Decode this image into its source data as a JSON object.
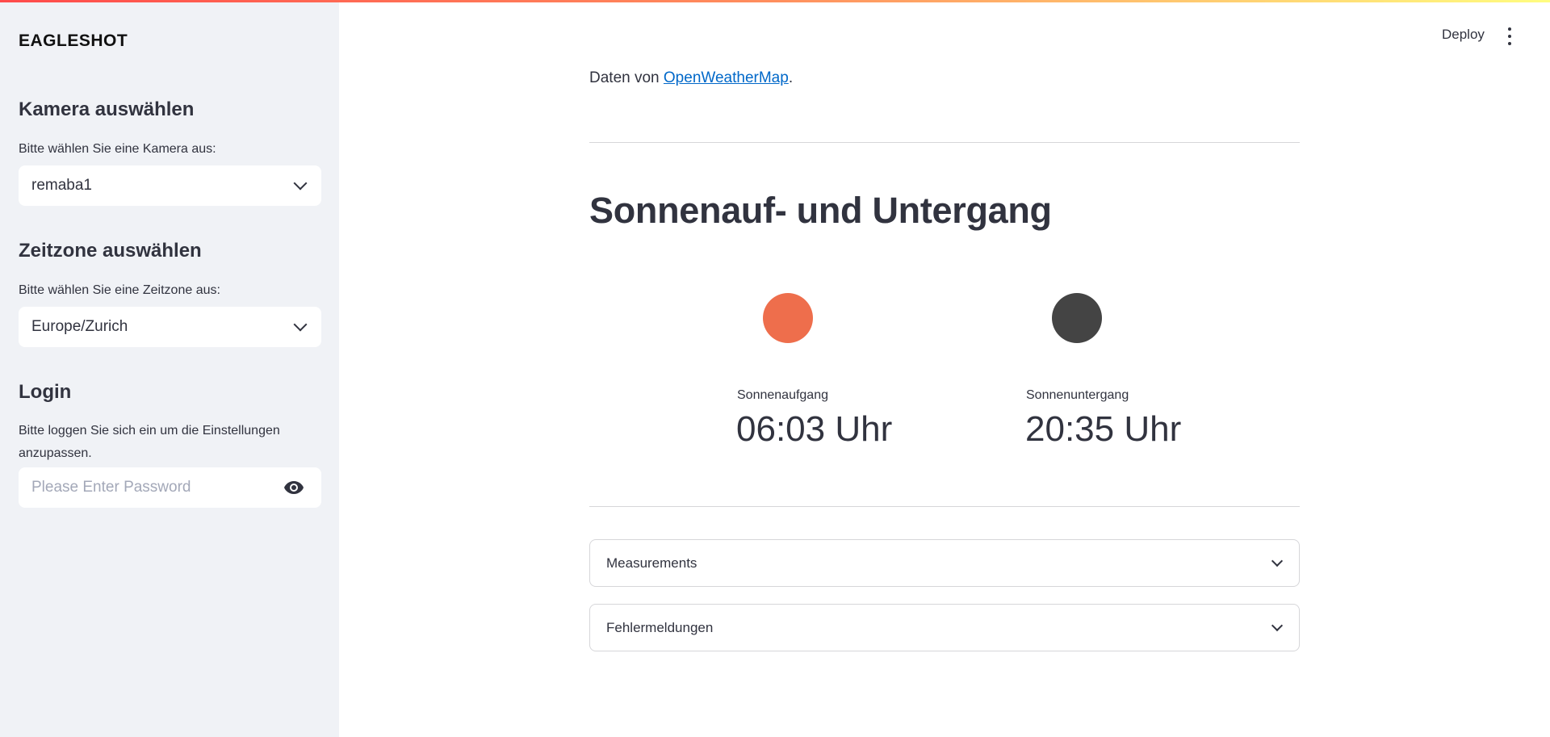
{
  "colors": {
    "accent_gradient": [
      "#ff4b4b",
      "#ff8f5e",
      "#fffd80"
    ],
    "sidebar_bg": "#f0f2f6",
    "link": "#0068c9",
    "sunrise_dot": "#ee6e4c",
    "sunset_dot": "#444444"
  },
  "sidebar": {
    "logo": "EAGLESHOT",
    "camera": {
      "heading": "Kamera auswählen",
      "label": "Bitte wählen Sie eine Kamera aus:",
      "selected": "remaba1"
    },
    "timezone": {
      "heading": "Zeitzone auswählen",
      "label": "Bitte wählen Sie eine Zeitzone aus:",
      "selected": "Europe/Zurich"
    },
    "login": {
      "heading": "Login",
      "label": "Bitte loggen Sie sich ein um die Einstellungen anzupassen.",
      "password_placeholder": "Please Enter Password",
      "password_value": ""
    }
  },
  "header": {
    "deploy_label": "Deploy",
    "menu_icon": "kebab-menu-icon"
  },
  "main": {
    "source_prefix": "Daten von ",
    "source_link": "OpenWeatherMap",
    "source_suffix": ".",
    "title": "Sonnenauf- und Untergang",
    "sunrise": {
      "label": "Sonnenaufgang",
      "value": "06:03 Uhr"
    },
    "sunset": {
      "label": "Sonnenuntergang",
      "value": "20:35 Uhr"
    },
    "expanders": [
      {
        "label": "Measurements"
      },
      {
        "label": "Fehlermeldungen"
      }
    ]
  }
}
